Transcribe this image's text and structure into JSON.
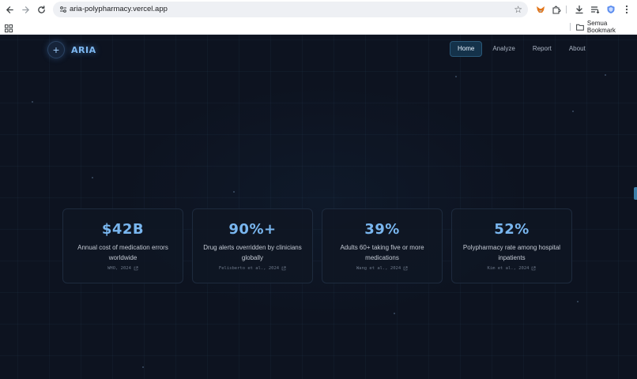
{
  "browser": {
    "url": "aria-polypharmacy.vercel.app",
    "bookmark_folder": "Semua Bookmark"
  },
  "colors": {
    "page_bg": "#0d1320",
    "accent": "#79b6ef",
    "nav_active_bg": "#14324a"
  },
  "site": {
    "logo_text": "ARIA",
    "logo_icon": "plus-icon"
  },
  "nav": {
    "items": [
      {
        "label": "Home",
        "active": true
      },
      {
        "label": "Analyze",
        "active": false
      },
      {
        "label": "Report",
        "active": false
      },
      {
        "label": "About",
        "active": false
      }
    ]
  },
  "stats": [
    {
      "value": "$42B",
      "description": "Annual cost of medication errors worldwide",
      "source": "WHO, 2024"
    },
    {
      "value": "90%+",
      "description": "Drug alerts overridden by clinicians globally",
      "source": "Felisberto et al., 2024"
    },
    {
      "value": "39%",
      "description": "Adults 60+ taking five or more medications",
      "source": "Wang et al., 2024"
    },
    {
      "value": "52%",
      "description": "Polypharmacy rate among hospital inpatients",
      "source": "Kim et al., 2024"
    }
  ]
}
